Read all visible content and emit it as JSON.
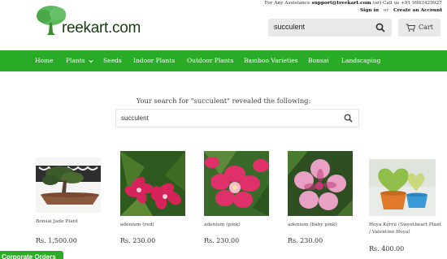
{
  "brand": {
    "logo_text": "reekart.com"
  },
  "header": {
    "assistance_prefix": "For Any Assistance",
    "assistance_email": "support@treekart.com",
    "assistance_suffix": "(or) Call us +91 9963429927",
    "sign_in": "Sign in",
    "or": "or",
    "create_account": "Create an Account",
    "search_value": "succulent",
    "cart_label": "Cart"
  },
  "nav": {
    "items": [
      "Home",
      "Plants",
      "Seeds",
      "Indoor Plants",
      "Outdoor Plants",
      "Bamboo Varieties",
      "Bonsai",
      "Landscaping"
    ]
  },
  "results": {
    "title": "Your search for \"succulent\" revealed the following:",
    "search_value": "succulent"
  },
  "products": [
    {
      "name": "Bonsai Jade Plant",
      "price": "Rs. 1,500.00"
    },
    {
      "name": "adenium (red)",
      "price": "Rs. 230.00"
    },
    {
      "name": "adenium (pink)",
      "price": "Rs. 230.00"
    },
    {
      "name": "adenium (baby pink)",
      "price": "Rs. 230.00"
    },
    {
      "name": "Hoya Kerrii (Sweetheart Plant / Valentine Hoya)",
      "price": "Rs. 400.00"
    }
  ],
  "corporate_orders": "Corporate Orders",
  "colors": {
    "brand_green": "#2aab27",
    "search_bg": "#e9e9e9"
  },
  "icons": {
    "search": "search-icon",
    "cart": "cart-icon",
    "nav_dropdown": "chevron-down-icon"
  }
}
